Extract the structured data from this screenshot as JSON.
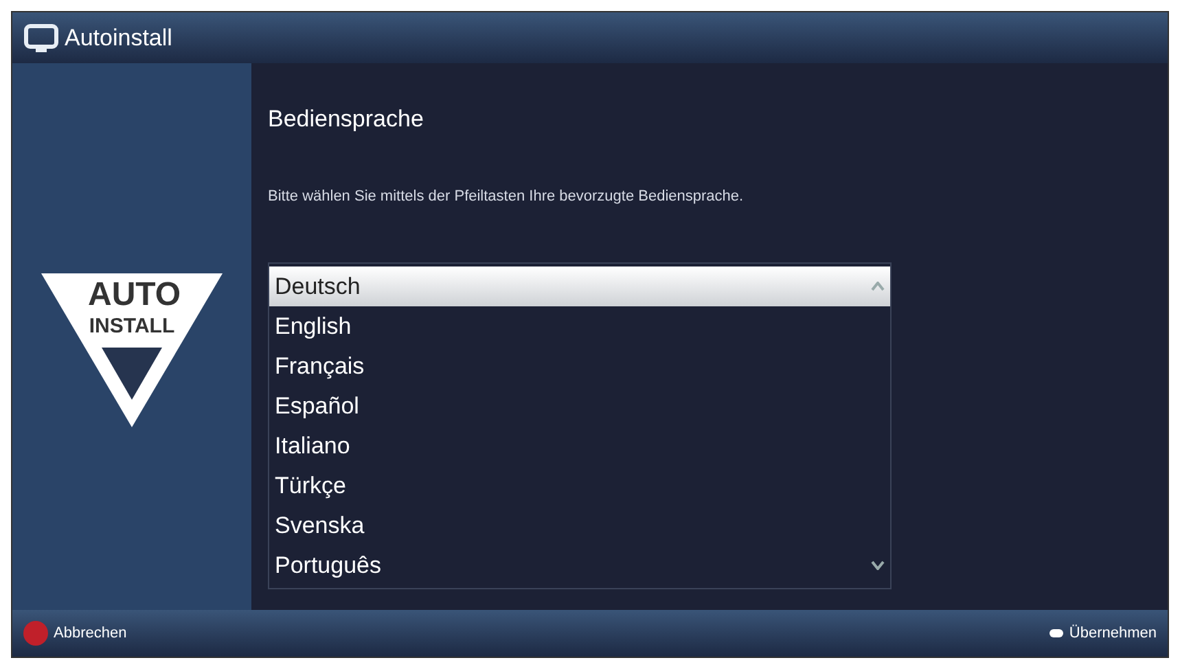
{
  "window": {
    "title": "Autoinstall"
  },
  "logo": {
    "line_1": "AUTO",
    "line_2": "INSTALL"
  },
  "heading": "Bediensprache",
  "instruction": "Bitte wählen Sie mittels der Pfeiltasten Ihre bevorzugte Bediensprache.",
  "languages": [
    {
      "label": "Deutsch",
      "selected": true
    },
    {
      "label": "English",
      "selected": false
    },
    {
      "label": "Français",
      "selected": false
    },
    {
      "label": "Español",
      "selected": false
    },
    {
      "label": "Italiano",
      "selected": false
    },
    {
      "label": "Türkçe",
      "selected": false
    },
    {
      "label": "Svenska",
      "selected": false
    },
    {
      "label": "Português",
      "selected": false
    }
  ],
  "footer": {
    "left": {
      "label": "Abbrechen",
      "color": "#c0202a"
    },
    "right": {
      "label": "Übernehmen"
    }
  }
}
